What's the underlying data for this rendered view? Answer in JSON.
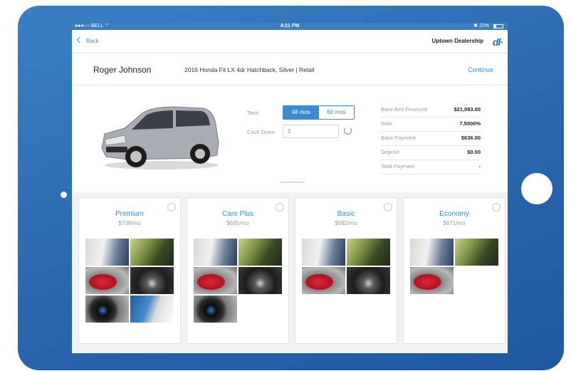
{
  "status_bar": {
    "carrier": "●●●○○ BELL ⌔",
    "time": "4:21 PM",
    "battery": "✱ 22%"
  },
  "nav": {
    "back_label": "Back",
    "dealer_name": "Uptown Dealership",
    "logo": "dl·"
  },
  "header": {
    "customer": "Roger Johnson",
    "vehicle": "2016 Honda Fit LX 4dr Hatchback, Silver  |  Retail",
    "continue_label": "Continue"
  },
  "deal": {
    "term_label": "Term",
    "term_options": [
      "48 mos",
      "60 mos"
    ],
    "term_selected": "48 mos",
    "cash_down_label": "Cash Down",
    "cash_down_placeholder": "$",
    "summary": [
      {
        "label": "Base Amt Financed",
        "value": "$21,083.00"
      },
      {
        "label": "Rate",
        "value": "7.5000%"
      },
      {
        "label": "Base Payment",
        "value": "$636.00"
      },
      {
        "label": "Deposit",
        "value": "$0.00"
      },
      {
        "label": "Total Payment",
        "value": "-"
      }
    ],
    "car_color": "#a9adb3"
  },
  "packages": [
    {
      "name": "Premium",
      "price": "$709/mo",
      "images": [
        "people-icon",
        "road-icon",
        "taillight-icon",
        "gearshift-icon",
        "knob-icon",
        "service-icon"
      ]
    },
    {
      "name": "Care Plus",
      "price": "$695/mo",
      "images": [
        "people-icon",
        "road-icon",
        "taillight-icon",
        "gearshift-icon",
        "knob-icon"
      ]
    },
    {
      "name": "Basic",
      "price": "$682/mo",
      "images": [
        "people-icon",
        "road-icon",
        "taillight-icon",
        "gearshift-icon"
      ]
    },
    {
      "name": "Economy",
      "price": "$671/mo",
      "images": [
        "people-icon",
        "road-icon",
        "taillight-icon"
      ]
    }
  ],
  "colors": {
    "accent": "#3a8bd6",
    "tablet": "#2a66ad"
  }
}
